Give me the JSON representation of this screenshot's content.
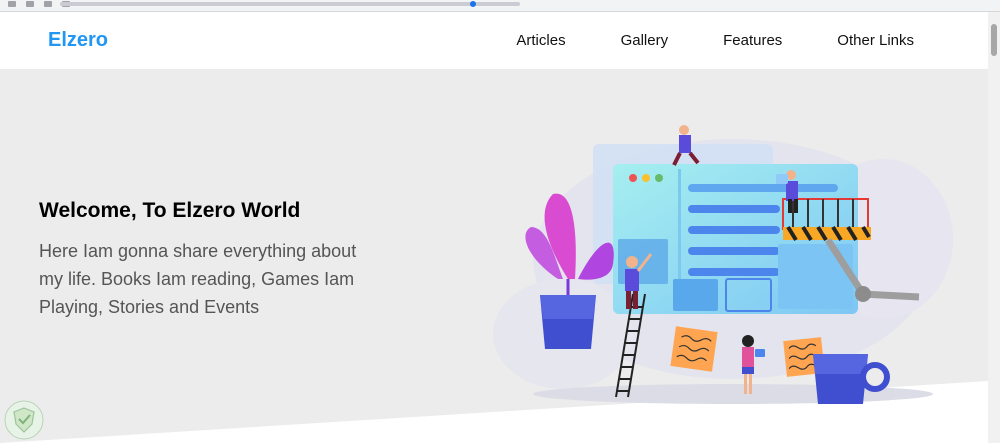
{
  "header": {
    "logo": "Elzero",
    "nav": [
      "Articles",
      "Gallery",
      "Features",
      "Other Links"
    ]
  },
  "landing": {
    "title": "Welcome, To Elzero World",
    "description": "Here Iam gonna share everything about my life. Books Iam reading, Games Iam Playing, Stories and Events"
  },
  "colors": {
    "brand": "#2196f3",
    "landing_bg": "#ececec",
    "header_bg": "#ffffff",
    "text_dark": "#000000",
    "text_muted": "#555555"
  },
  "icons": [
    "browser-window-illustration",
    "plant-pot-icon",
    "ladder-icon",
    "person-figure",
    "scaffold-lift-icon",
    "coffee-cup-icon",
    "shield-badge-icon"
  ]
}
